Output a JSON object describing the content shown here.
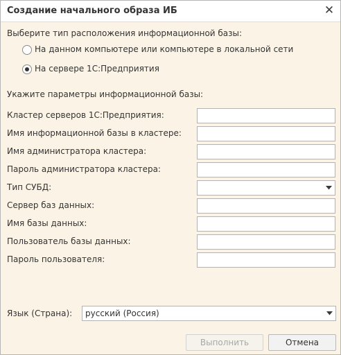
{
  "window": {
    "title": "Создание начального образа ИБ",
    "close_icon": "close-icon"
  },
  "location": {
    "prompt": "Выберите тип расположения информационной базы:",
    "options": [
      {
        "label": "На данном компьютере или компьютере в локальной сети",
        "checked": false
      },
      {
        "label": "На сервере 1С:Предприятия",
        "checked": true
      }
    ]
  },
  "params": {
    "prompt": "Укажите параметры информационной базы:",
    "fields": [
      {
        "label": "Кластер серверов 1С:Предприятия:",
        "value": ""
      },
      {
        "label": "Имя информационной базы в кластере:",
        "value": ""
      },
      {
        "label": "Имя администратора кластера:",
        "value": ""
      },
      {
        "label": "Пароль администратора кластера:",
        "value": ""
      },
      {
        "label": "Тип СУБД:",
        "value": ""
      },
      {
        "label": "Сервер баз данных:",
        "value": ""
      },
      {
        "label": "Имя базы данных:",
        "value": ""
      },
      {
        "label": "Пользователь базы данных:",
        "value": ""
      },
      {
        "label": "Пароль пользователя:",
        "value": ""
      }
    ],
    "language_label": "Язык (Страна):",
    "language_value": "русский (Россия)"
  },
  "buttons": {
    "execute": "Выполнить",
    "cancel": "Отмена"
  }
}
